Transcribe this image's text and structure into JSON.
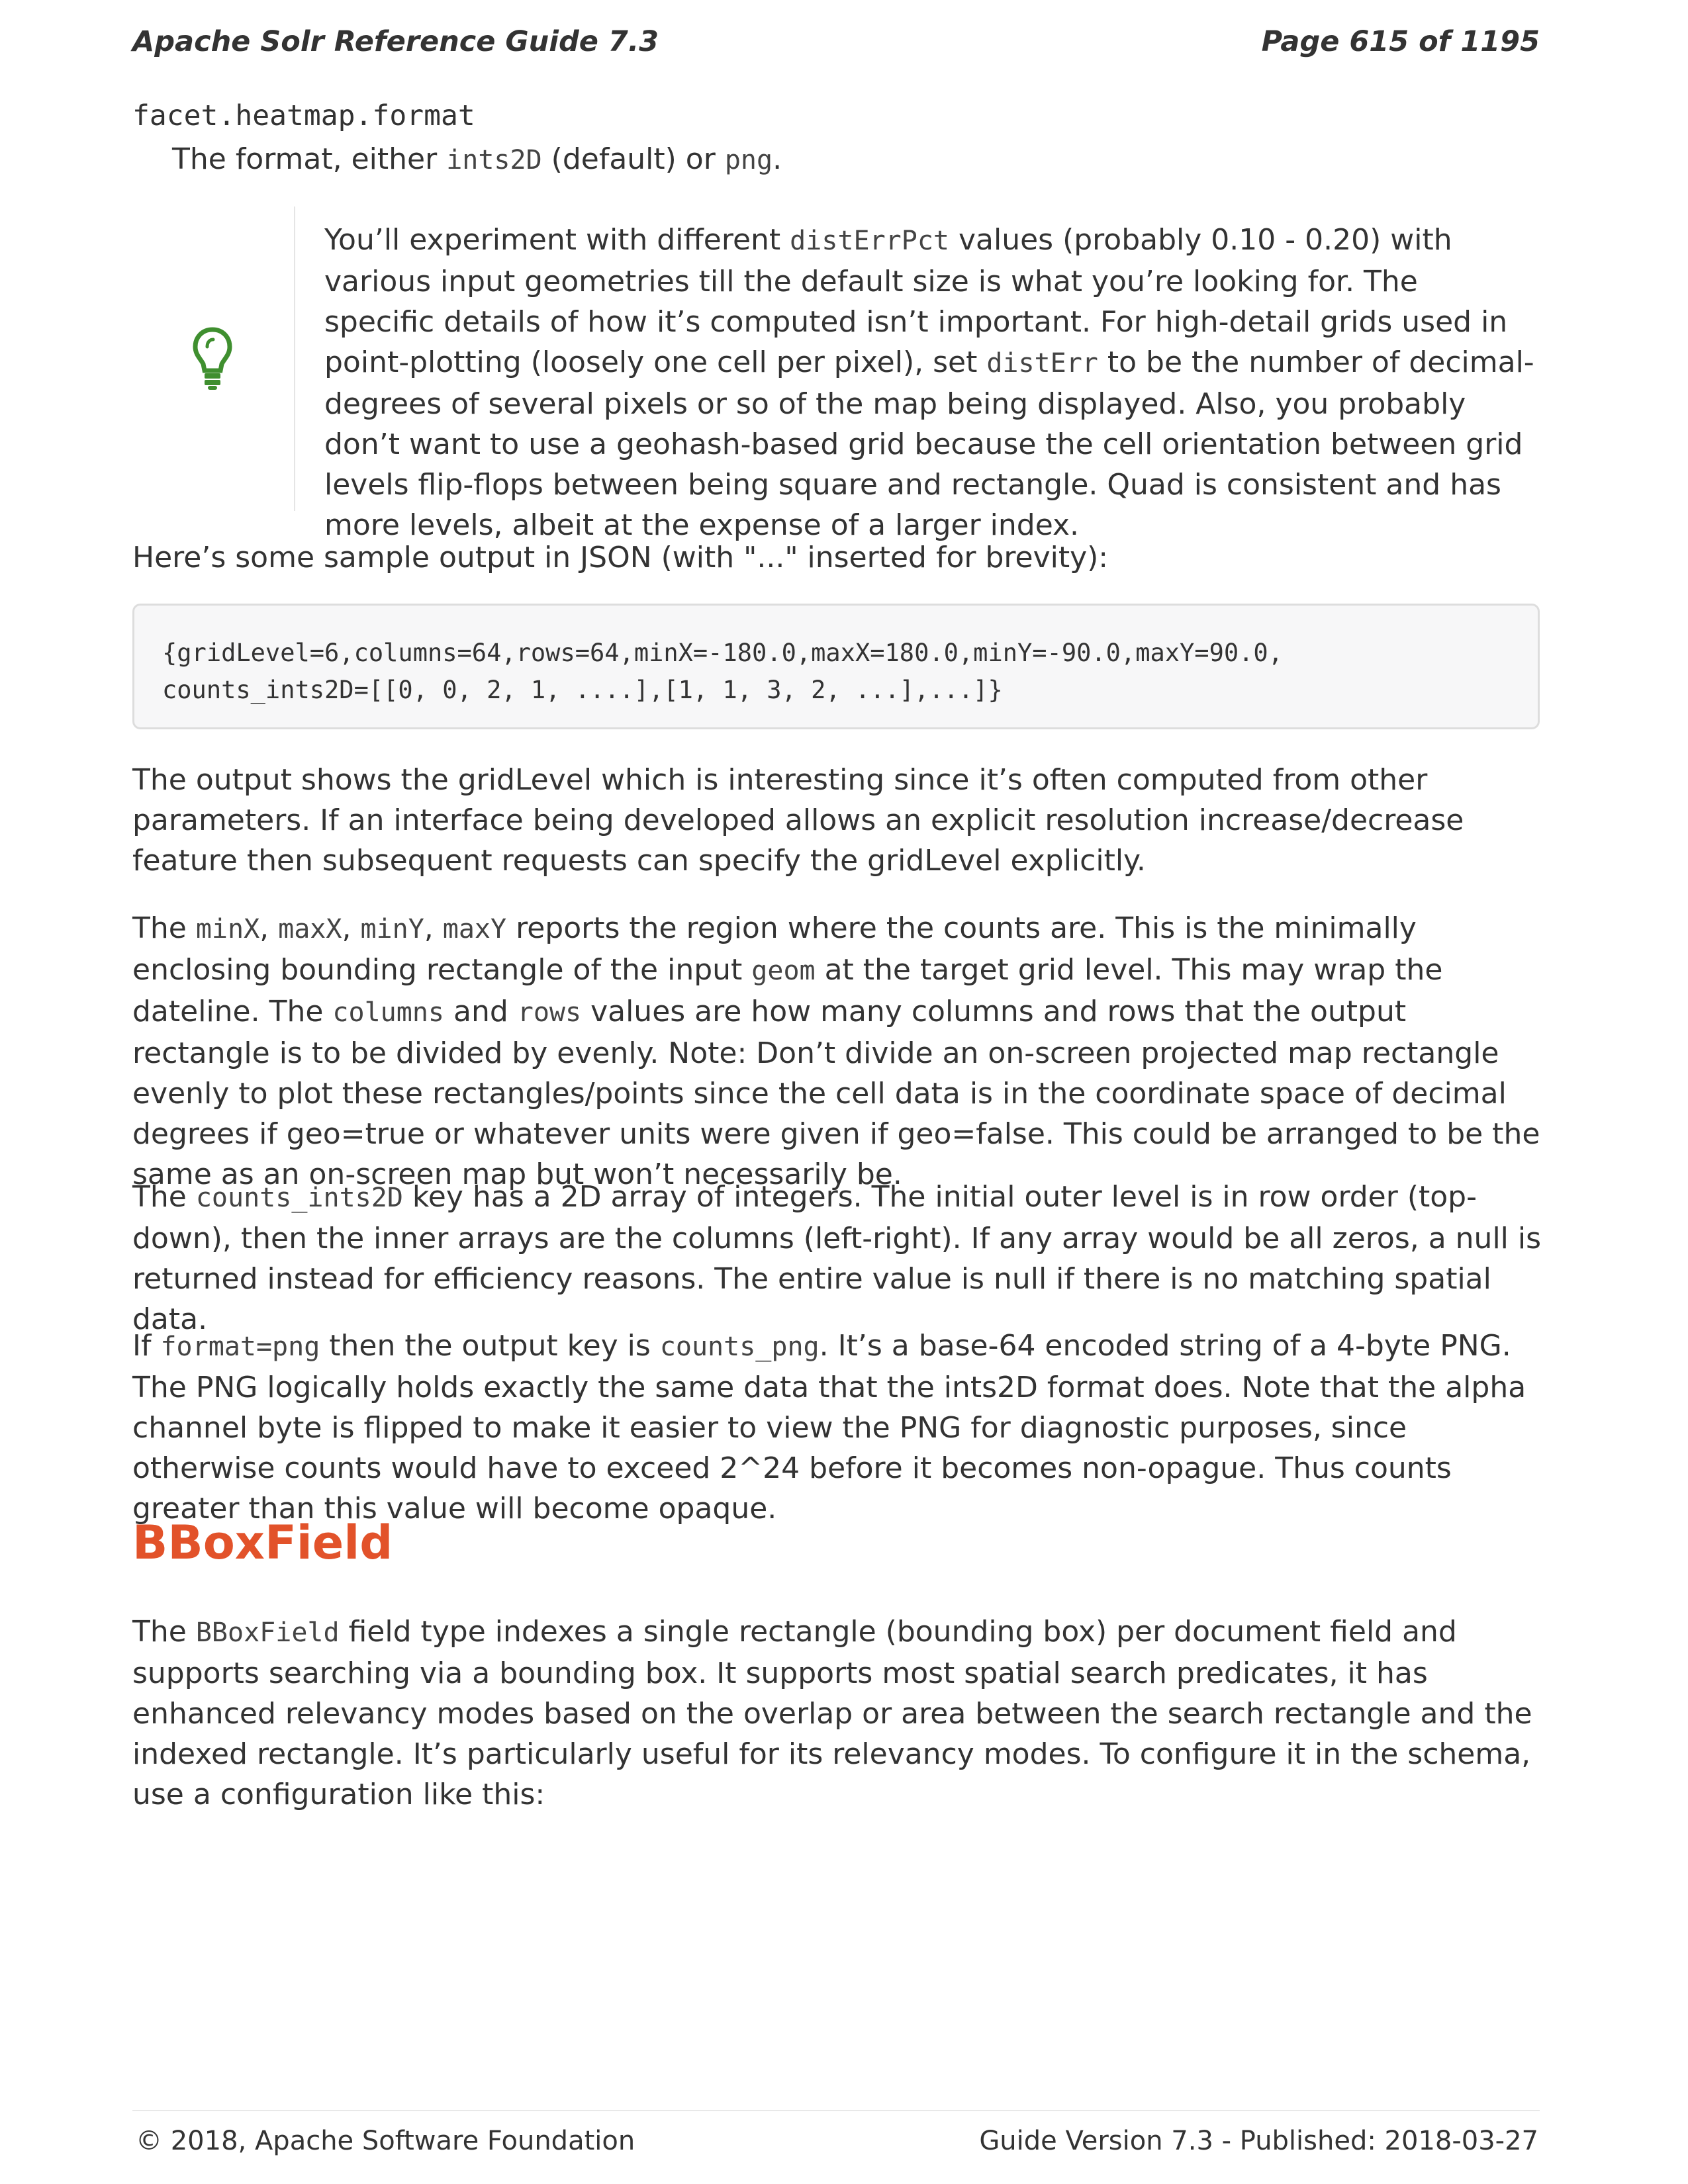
{
  "header": {
    "title": "Apache Solr Reference Guide 7.3",
    "page": "Page 615 of 1195"
  },
  "param": {
    "name": "facet.heatmap.format",
    "desc_pre": "The format, either ",
    "desc_code1": "ints2D",
    "desc_mid": " (default) or ",
    "desc_code2": "png",
    "desc_post": "."
  },
  "tip": {
    "icon": "lightbulb-icon",
    "t1": "You’ll experiment with different ",
    "c1": "distErrPct",
    "t2": " values (probably 0.10 - 0.20) with various input geometries till the default size is what you’re looking for. The specific details of how it’s computed isn’t important. For high-detail grids used in point-plotting (loosely one cell per pixel), set ",
    "c2": "distErr",
    "t3": " to be the number of decimal-degrees of several pixels or so of the map being displayed. Also, you probably don’t want to use a geohash-based grid because the cell orientation between grid levels flip-flops between being square and rectangle. Quad is consistent and has more levels, albeit at the expense of a larger index."
  },
  "sample_intro": "Here’s some sample output in JSON (with \"...\" inserted for brevity):",
  "code_sample": "{gridLevel=6,columns=64,rows=64,minX=-180.0,maxX=180.0,minY=-90.0,maxY=90.0,\ncounts_ints2D=[[0, 0, 2, 1, ....],[1, 1, 3, 2, ...],...]}",
  "para_gridlevel": "The output shows the gridLevel which is interesting since it’s often computed from other parameters. If an interface being developed allows an explicit resolution increase/decrease feature then subsequent requests can specify the gridLevel explicitly.",
  "para_minmax": {
    "t1": "The ",
    "c1": "minX",
    "t2": ", ",
    "c2": "maxX",
    "t3": ", ",
    "c3": "minY",
    "t4": ", ",
    "c4": "maxY",
    "t5": " reports the region where the counts are. This is the minimally enclosing bounding rectangle of the input ",
    "c5": "geom",
    "t6": " at the target grid level. This may wrap the dateline. The ",
    "c6": "columns",
    "t7": " and ",
    "c7": "rows",
    "t8": " values are how many columns and rows that the output rectangle is to be divided by evenly. Note: Don’t divide an on-screen projected map rectangle evenly to plot these rectangles/points since the cell data is in the coordinate space of decimal degrees if geo=true or whatever units were given if geo=false. This could be arranged to be the same as an on-screen map but won’t necessarily be."
  },
  "para_counts": {
    "t1": "The ",
    "c1": "counts_ints2D",
    "t2": " key has a 2D array of integers. The initial outer level is in row order (top-down), then the inner arrays are the columns (left-right). If any array would be all zeros, a null is returned instead for efficiency reasons. The entire value is null if there is no matching spatial data."
  },
  "para_png": {
    "t1": "If ",
    "c1": "format=png",
    "t2": " then the output key is ",
    "c2": "counts_png",
    "t3": ". It’s a base-64 encoded string of a 4-byte PNG. The PNG logically holds exactly the same data that the ints2D format does. Note that the alpha channel byte is flipped to make it easier to view the PNG for diagnostic purposes, since otherwise counts would have to exceed 2^24 before it becomes non-opague. Thus counts greater than this value will become opaque."
  },
  "section": {
    "heading": "BBoxField",
    "t1": "The ",
    "c1": "BBoxField",
    "t2": " field type indexes a single rectangle (bounding box) per document field and supports searching via a bounding box. It supports most spatial search predicates, it has enhanced relevancy modes based on the overlap or area between the search rectangle and the indexed rectangle. It’s particularly useful for its relevancy modes. To configure it in the schema, use a configuration like this:"
  },
  "footer": {
    "copyright": "© 2018, Apache Software Foundation",
    "version": "Guide Version 7.3 - Published: 2018-03-27"
  },
  "colors": {
    "heading": "#e2522a",
    "tip_icon": "#3f8f2f",
    "text": "#333333"
  }
}
